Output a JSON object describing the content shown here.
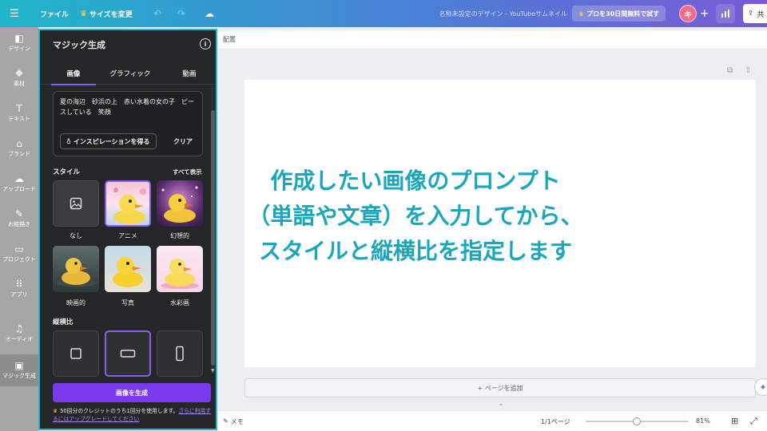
{
  "topbar": {
    "menu_icon": "☰",
    "file_label": "ファイル",
    "resize_label": "サイズを変更",
    "undo_icon": "↶",
    "redo_icon": "↷",
    "cloud_icon": "☁",
    "doc_title": "名称未設定のデザイン - YouTubeサムネイル",
    "pro_label": "プロを30日間無料で試す",
    "avatar_initial": "キ",
    "plus_icon": "+",
    "share_label": "共"
  },
  "rail": {
    "items": [
      {
        "label": "デザイン",
        "icon": "◧"
      },
      {
        "label": "素材",
        "icon": "❖"
      },
      {
        "label": "テキスト",
        "icon": "T"
      },
      {
        "label": "ブランド",
        "icon": "⌂"
      },
      {
        "label": "アップロード",
        "icon": "☁"
      },
      {
        "label": "お絵描き",
        "icon": "✎"
      },
      {
        "label": "プロジェクト",
        "icon": "▭"
      },
      {
        "label": "アプリ",
        "icon": "⠿"
      },
      {
        "label": "オーディオ",
        "icon": "♫"
      },
      {
        "label": "マジック生成",
        "icon": "▣"
      }
    ]
  },
  "panel": {
    "title": "マジック生成",
    "tabs": [
      "画像",
      "グラフィック",
      "動画"
    ],
    "prompt": "夏の海辺　砂浜の上　赤い水着の女の子　ピースしている　笑顔",
    "inspiration_label": "インスピレーションを得る",
    "clear_label": "クリア",
    "style_heading": "スタイル",
    "see_all": "すべて表示",
    "styles": [
      {
        "label": "なし"
      },
      {
        "label": "アニメ"
      },
      {
        "label": "幻想的"
      },
      {
        "label": "映画的"
      },
      {
        "label": "写真"
      },
      {
        "label": "水彩画"
      }
    ],
    "ratio_heading": "縦横比",
    "generate_label": "画像を生成",
    "credit_text": "50回分のクレジットのうち1回分を使用します。",
    "credit_link": "さらに利用するにはアップグレードしてください"
  },
  "canvas": {
    "subbar_label": "配置",
    "overlay_lines": [
      "作成したい画像のプロンプト",
      "（単語や文章）を入力してから、",
      "スタイルと縦横比を指定します"
    ],
    "add_page_label": "+ ページを追加",
    "collapse_icon": "⌃"
  },
  "bottombar": {
    "memo_label": "メモ",
    "page_label": "1/1ページ",
    "zoom_label": "81%",
    "zoom_value": 0.5
  },
  "colors": {
    "accent": "#7c3aed",
    "highlight": "#25b7cf",
    "overlay_text": "#1aa7be"
  }
}
